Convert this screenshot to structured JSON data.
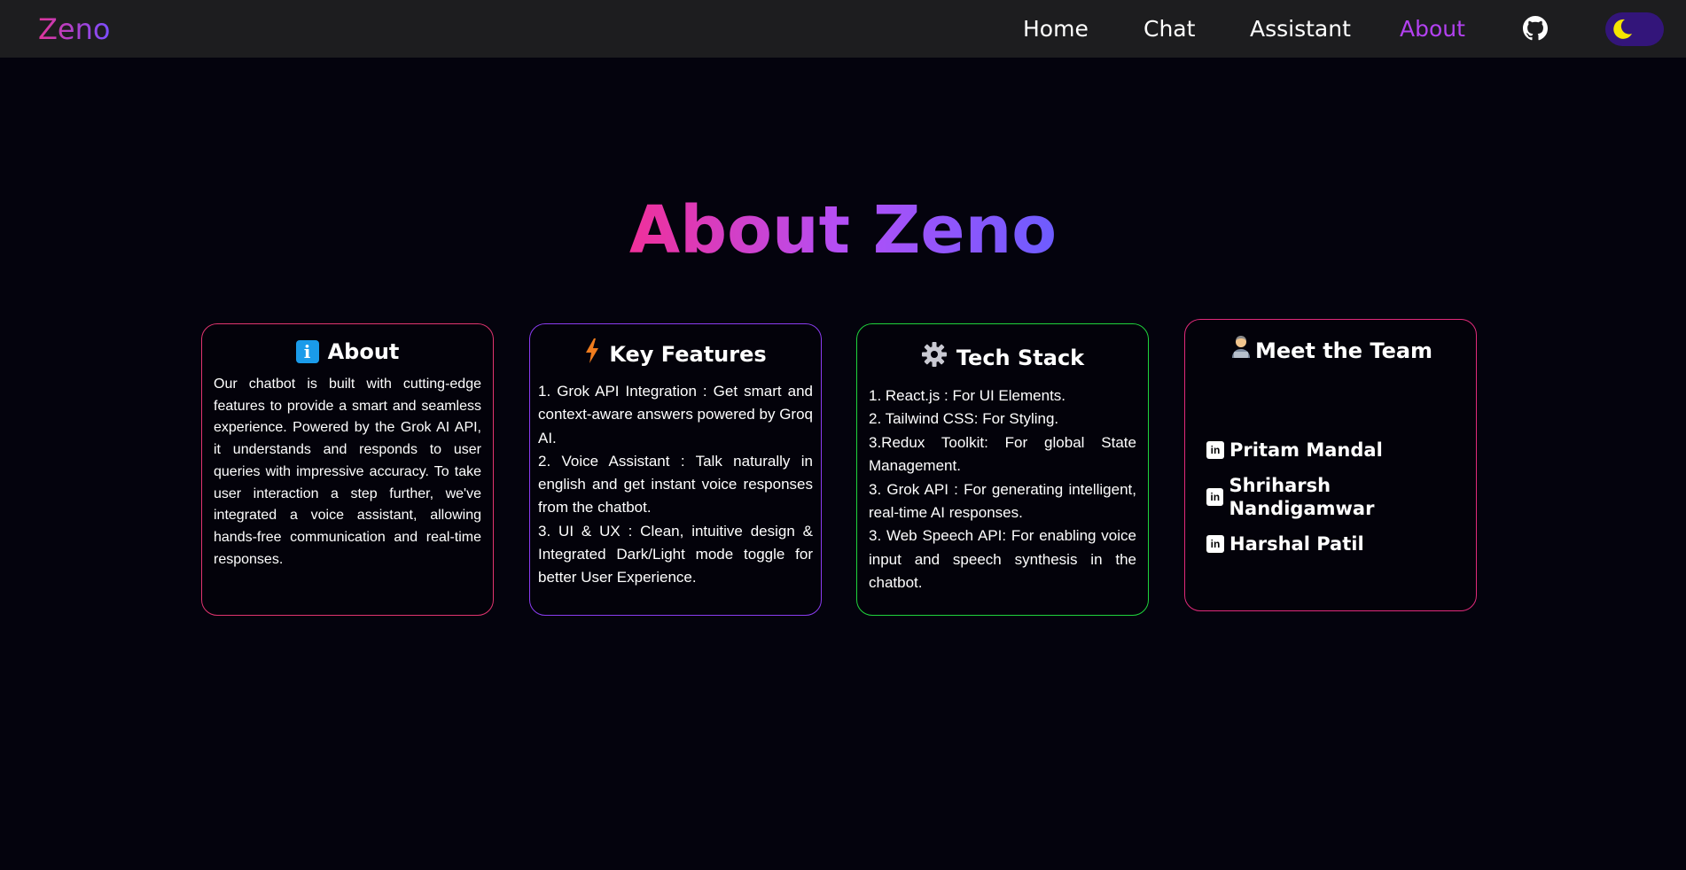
{
  "nav": {
    "brand": "Zeno",
    "links": [
      "Home",
      "Chat",
      "Assistant",
      "About"
    ],
    "active": "About",
    "github_icon": "github-icon",
    "theme_toggle_icon": "moon-icon"
  },
  "hero": {
    "title": "About Zeno"
  },
  "cards": {
    "about": {
      "icon": "info-icon",
      "title": "About",
      "body": "Our chatbot is built with cutting-edge features to provide a smart and seamless experience. Powered by the Grok AI API, it understands and responds to user queries with impressive accuracy. To take user interaction a step further, we've integrated a voice assistant, allowing hands-free communication and real-time responses."
    },
    "features": {
      "icon": "lightning-icon",
      "title": "Key Features",
      "items": [
        "1. Grok API Integration : Get smart and context-aware answers powered by Groq AI.",
        "2. Voice Assistant : Talk naturally in english and get instant voice responses from the chatbot.",
        "3. UI & UX : Clean, intuitive design & Integrated Dark/Light mode toggle for better User Experience."
      ]
    },
    "tech": {
      "icon": "gear-icon",
      "title": "Tech Stack",
      "items": [
        "1. React.js : For UI Elements.",
        "2. Tailwind CSS: For Styling.",
        "3.Redux Toolkit: For global State Management.",
        "3. Grok API : For generating intelligent, real-time AI responses.",
        "3. Web Speech API: For enabling voice input and speech synthesis in the chatbot."
      ]
    },
    "team": {
      "icon": "technologist-icon",
      "title": "Meet the Team",
      "member_icon": "linkedin-icon",
      "members": [
        "Pritam Mandal",
        "Shriharsh Nandigamwar",
        "Harshal Patil"
      ]
    }
  },
  "colors": {
    "background": "#04030d",
    "navbar": "#1d1d1f",
    "active_link": "#b341f0",
    "about_border": "#e0346f",
    "features_border": "#8a3cf0",
    "tech_border": "#1fd33c",
    "team_border": "#e02a7a"
  }
}
